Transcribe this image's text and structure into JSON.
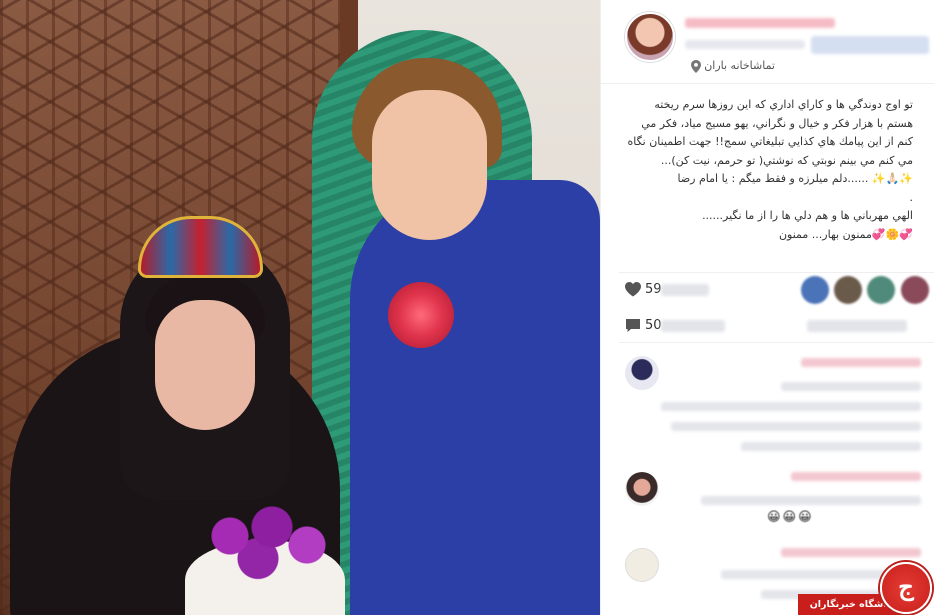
{
  "post": {
    "location": "تماشاخانه باران",
    "caption_lines": [
      "تو اوج دوندگي ها و كاراي اداري كه اين روزها سرم ريخته",
      "هستم با هزار فكر و خيال و نگراني، يهو مسيج مياد، فكر مي",
      "كنم از اين پيامك هاي كذايي تبليغاتي سمج!! جهت اطمينان نگاه",
      "مي كنم مي بينم نوبتي كه نوشتي( تو حرمم، نيت كن)...",
      "✨🙏🏻✨ ......دلم ميلرزه و فقط ميگم : يا امام رضا",
      ".",
      "الهي مهرباني ها و هم دلي ها را از ما نگير......",
      "💞🌼💞ممنون بهار... ممنون"
    ],
    "likes_count_prefix": "59",
    "comments_count_prefix": "50",
    "comment_emojis": "😀😀😀"
  },
  "colors": {
    "accent_blur": "#f5bcc6",
    "watermark_red": "#c91f1c",
    "robe_blue": "#2c3fa6",
    "scarf_green": "#2e9a78"
  },
  "watermark": {
    "text": "باشگاه خبرنگاران",
    "glyph": "ج"
  },
  "icons": {
    "location": "map-pin-icon",
    "likes": "heart-icon",
    "comments": "speech-bubble-icon"
  }
}
